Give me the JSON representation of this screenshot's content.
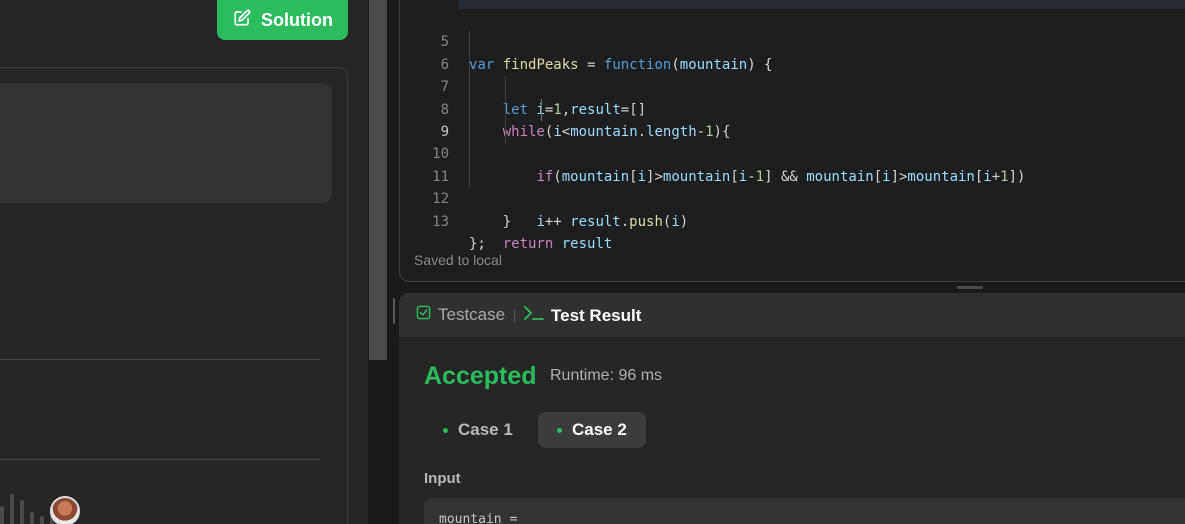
{
  "left_panel": {
    "solution_label": "Solution"
  },
  "editor": {
    "lines": [
      {
        "num": "5"
      },
      {
        "num": "6"
      },
      {
        "num": "7"
      },
      {
        "num": "8"
      },
      {
        "num": "9"
      },
      {
        "num": "10"
      },
      {
        "num": "11"
      },
      {
        "num": "12"
      },
      {
        "num": "13"
      }
    ],
    "saved_status": "Saved to local"
  },
  "result": {
    "tabs": {
      "testcase": "Testcase",
      "test_result": "Test Result"
    },
    "status": "Accepted",
    "runtime": "Runtime: 96 ms",
    "cases": [
      "Case 1",
      "Case 2"
    ],
    "input_label": "Input",
    "input_value": "mountain ="
  },
  "colors": {
    "accent": "#2cbb5d",
    "background": "#1a1a1a",
    "panel": "#262626"
  }
}
